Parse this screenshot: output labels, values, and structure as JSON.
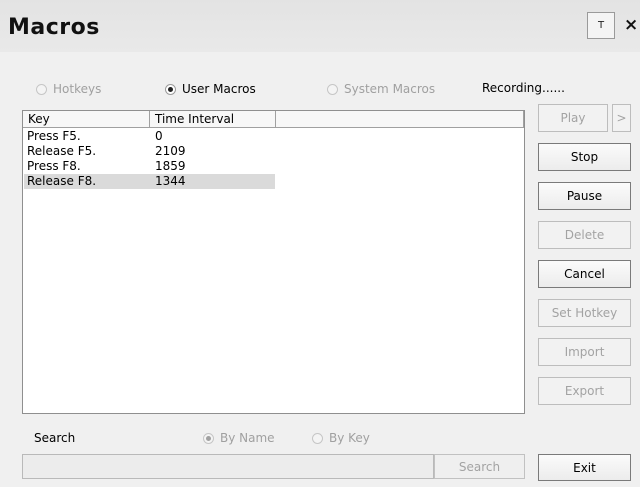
{
  "window": {
    "title": "Macros",
    "pin_label": "T",
    "close_label": "×"
  },
  "scope": {
    "hotkeys": "Hotkeys",
    "user_macros": "User Macros",
    "system_macros": "System Macros",
    "selected": "User Macros"
  },
  "status": "Recording......",
  "table": {
    "columns": [
      "Key",
      "Time Interval",
      ""
    ],
    "rows": [
      {
        "key": "Press F5.",
        "interval": "0"
      },
      {
        "key": "Release F5.",
        "interval": "2109"
      },
      {
        "key": "Press F8.",
        "interval": "1859"
      },
      {
        "key": "Release F8.",
        "interval": "1344"
      }
    ],
    "selected_row": 3
  },
  "buttons": {
    "play": "Play",
    "play_more": ">",
    "stop": "Stop",
    "pause": "Pause",
    "delete": "Delete",
    "cancel": "Cancel",
    "set_hotkey": "Set Hotkey",
    "import": "Import",
    "export": "Export",
    "exit": "Exit"
  },
  "search": {
    "label": "Search",
    "by_name": "By Name",
    "by_key": "By Key",
    "selected": "By Name",
    "value": "",
    "button": "Search"
  }
}
